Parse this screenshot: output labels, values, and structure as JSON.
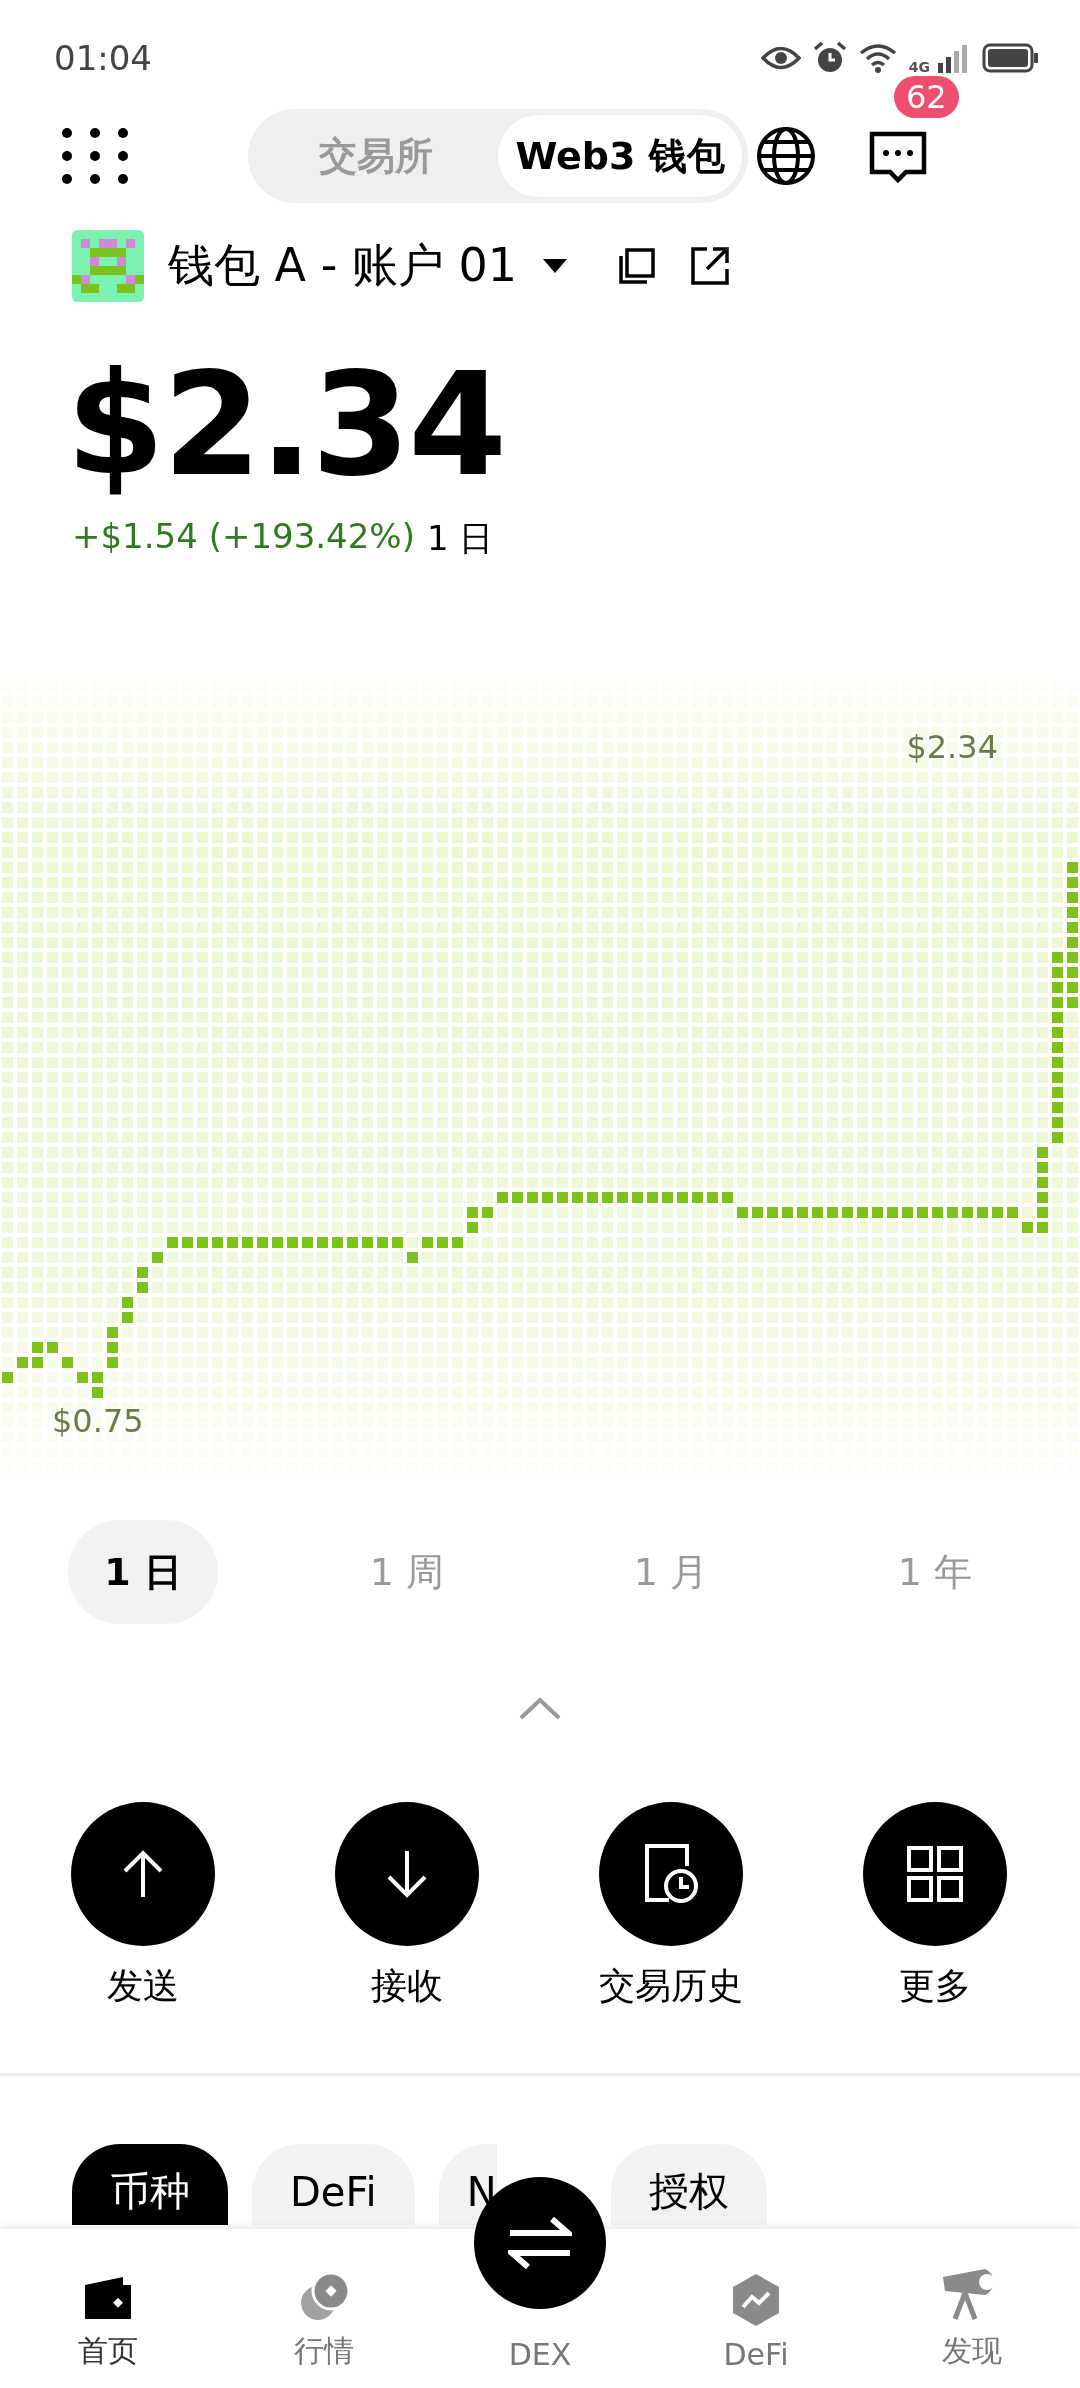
{
  "status_bar": {
    "time": "01:04",
    "network": "4G"
  },
  "header": {
    "segments": [
      {
        "label": "交易所",
        "selected": false
      },
      {
        "label": "Web3 钱包",
        "selected": true
      }
    ],
    "messages_badge": "62"
  },
  "account": {
    "name": "钱包 A - 账户 01"
  },
  "balance": {
    "value": "$2.34",
    "change": "+$1.54 (+193.42%)",
    "period": "1 日"
  },
  "chart": {
    "max_label": "$2.34",
    "min_label": "$0.75"
  },
  "periods": [
    {
      "label": "1 日",
      "selected": true
    },
    {
      "label": "1 周",
      "selected": false
    },
    {
      "label": "1 月",
      "selected": false
    },
    {
      "label": "1 年",
      "selected": false
    }
  ],
  "actions": [
    {
      "kind": "send",
      "label": "发送"
    },
    {
      "kind": "receive",
      "label": "接收"
    },
    {
      "kind": "history",
      "label": "交易历史"
    },
    {
      "kind": "more",
      "label": "更多"
    }
  ],
  "asset_tabs": [
    {
      "label": "币种",
      "selected": true
    },
    {
      "label": "DeFi",
      "selected": false
    },
    {
      "label": "N",
      "selected": false
    },
    {
      "label": "授权",
      "selected": false
    }
  ],
  "bottom_nav": [
    {
      "kind": "home",
      "label": "首页",
      "selected": true
    },
    {
      "kind": "market",
      "label": "行情",
      "selected": false
    },
    {
      "kind": "dex",
      "label": "DEX",
      "selected": false
    },
    {
      "kind": "defi",
      "label": "DeFi",
      "selected": false
    },
    {
      "kind": "discover",
      "label": "发现",
      "selected": false
    }
  ]
}
